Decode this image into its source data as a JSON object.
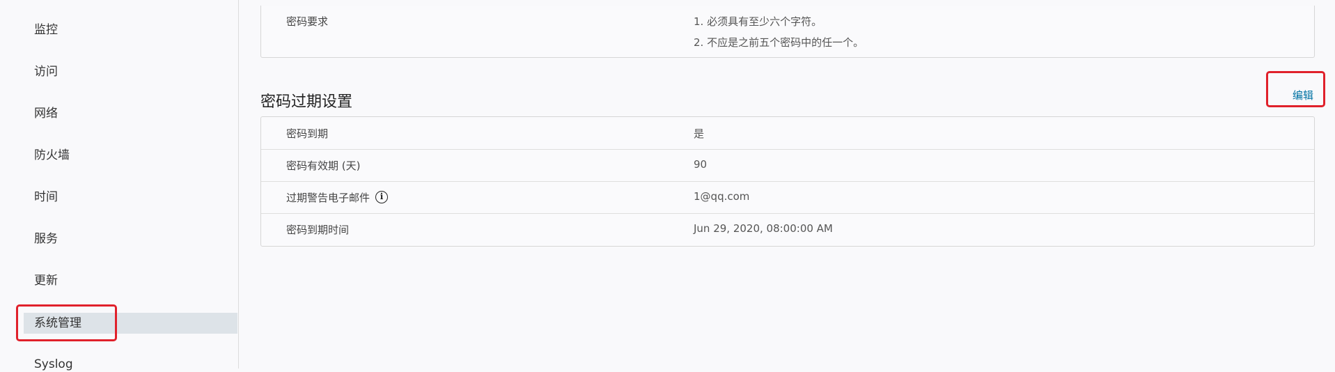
{
  "sidebar": {
    "items": [
      {
        "label": "监控"
      },
      {
        "label": "访问"
      },
      {
        "label": "网络"
      },
      {
        "label": "防火墙"
      },
      {
        "label": "时间"
      },
      {
        "label": "服务"
      },
      {
        "label": "更新"
      },
      {
        "label": "系统管理",
        "active": true
      },
      {
        "label": "Syslog"
      }
    ]
  },
  "password_requirements": {
    "label": "密码要求",
    "rules": [
      "1. 必须具有至少六个字符。",
      "2. 不应是之前五个密码中的任一个。"
    ]
  },
  "password_expiry": {
    "title": "密码过期设置",
    "edit_label": "编辑",
    "rows": [
      {
        "label": "密码到期",
        "value": "是"
      },
      {
        "label": "密码有效期 (天)",
        "value": "90"
      },
      {
        "label": "过期警告电子邮件",
        "value": "1@qq.com",
        "info_icon": "info-icon"
      },
      {
        "label": "密码到期时间",
        "value": "Jun 29, 2020, 08:00:00 AM"
      }
    ]
  },
  "colors": {
    "annotation": "#e0212b",
    "link": "#0072a3",
    "active_nav": "#dde3e8"
  }
}
